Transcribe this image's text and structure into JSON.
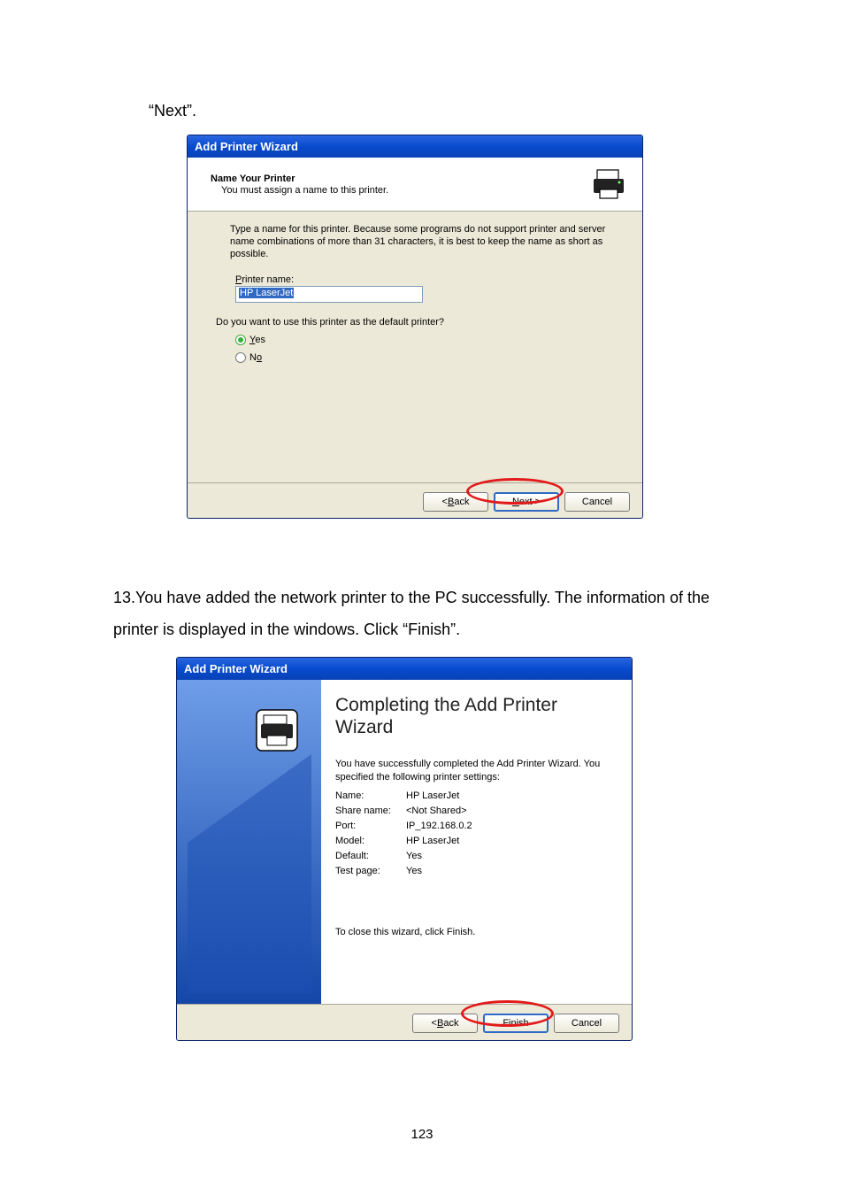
{
  "intro_text": "“Next”.",
  "step13_text": "13.You have added the network printer to the PC successfully. The information of the printer is displayed in the windows. Click “Finish”.",
  "page_number": "123",
  "dialog1": {
    "title": "Add Printer Wizard",
    "header_title": "Name Your Printer",
    "header_sub": "You must assign a name to this printer.",
    "body_para": "Type a name for this printer. Because some programs do not support printer and server name combinations of more than 31 characters, it is best to keep the name as short as possible.",
    "field_label_pre": "P",
    "field_label_post": "rinter name:",
    "printer_name_value": "HP LaserJet",
    "question": "Do you want to use this printer as the default printer?",
    "radio_yes_u": "Y",
    "radio_yes_rest": "es",
    "radio_no_pre": "N",
    "radio_no_u": "o",
    "back_pre": "< ",
    "back_u": "B",
    "back_post": "ack",
    "next_u": "N",
    "next_post": "ext >",
    "cancel": "Cancel"
  },
  "dialog2": {
    "title": "Add Printer Wizard",
    "heading": "Completing the Add Printer Wizard",
    "para": "You have successfully completed the Add Printer Wizard. You specified the following printer settings:",
    "rows": {
      "name_k": "Name:",
      "name_v": "HP LaserJet",
      "share_k": "Share name:",
      "share_v": "<Not Shared>",
      "port_k": "Port:",
      "port_v": "IP_192.168.0.2",
      "model_k": "Model:",
      "model_v": "HP LaserJet",
      "default_k": "Default:",
      "default_v": "Yes",
      "test_k": "Test page:",
      "test_v": "Yes"
    },
    "close_text": "To close this wizard, click Finish.",
    "back_pre": "< ",
    "back_u": "B",
    "back_post": "ack",
    "finish": "Finish",
    "cancel": "Cancel"
  }
}
